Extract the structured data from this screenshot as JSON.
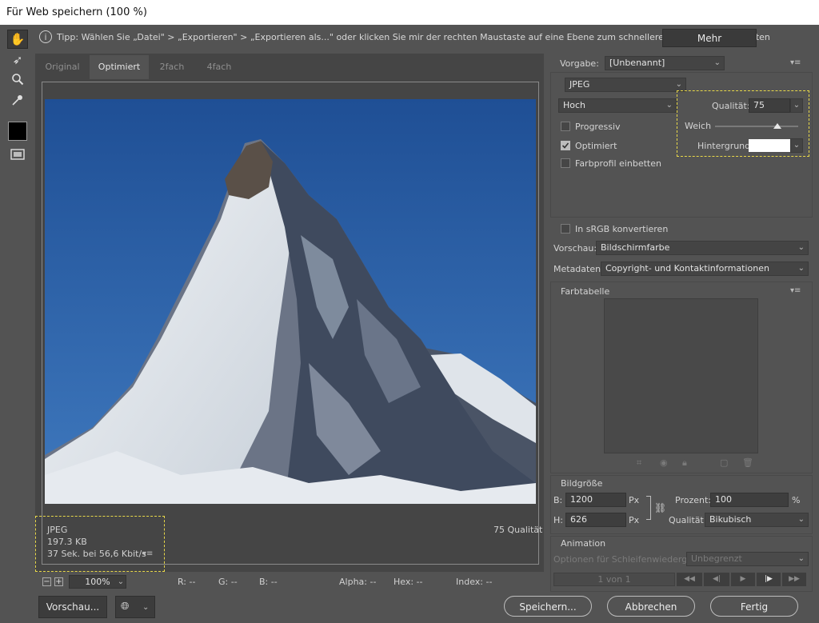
{
  "window": {
    "title": "Für Web speichern (100 %)"
  },
  "tip": {
    "text": "Tipp: Wählen Sie „Datei\" > „Exportieren\" > „Exportieren als...\" oder klicken Sie mir der rechten Maustaste auf eine Ebene zum schnelleren Export von Elementen",
    "more_label": "Mehr"
  },
  "tabs": [
    "Original",
    "Optimiert",
    "2fach",
    "4fach"
  ],
  "image_info": {
    "format": "JPEG",
    "size": "197.3 KB",
    "time": "37 Sek. bei 56,6 Kbit/s",
    "quality_label": "75 Qualität"
  },
  "statusbar": {
    "zoom": "100%",
    "r": "R: --",
    "g": "G: --",
    "b": "B: --",
    "alpha": "Alpha: --",
    "hex": "Hex: --",
    "index": "Index: --"
  },
  "settings": {
    "preset_label": "Vorgabe:",
    "preset_value": "[Unbenannt]",
    "format": "JPEG",
    "compression": "Hoch",
    "quality_label": "Qualität:",
    "quality_value": "75",
    "blur_label": "Weich",
    "blur_level": 0.75,
    "matte_label": "Hintergrund:",
    "progressive_label": "Progressiv",
    "optimized_label": "Optimiert",
    "embed_profile_label": "Farbprofil einbetten",
    "srgb_label": "In sRGB konvertieren",
    "preview_label": "Vorschau:",
    "preview_value": "Bildschirmfarbe",
    "metadata_label": "Metadaten:",
    "metadata_value": "Copyright- und Kontaktinformationen"
  },
  "color_table": {
    "title": "Farbtabelle"
  },
  "image_size": {
    "title": "Bildgröße",
    "w_label": "B:",
    "w_value": "1200",
    "h_label": "H:",
    "h_value": "626",
    "unit": "Px",
    "percent_label": "Prozent:",
    "percent_value": "100",
    "percent_unit": "%",
    "quality_label": "Qualität:",
    "quality_value": "Bikubisch"
  },
  "animation": {
    "title": "Animation",
    "loop_label": "Optionen für Schleifenwiedergabe:",
    "loop_value": "Unbegrenzt",
    "frame": "1 von 1"
  },
  "footer": {
    "preview": "Vorschau...",
    "save": "Speichern...",
    "cancel": "Abbrechen",
    "done": "Fertig"
  },
  "colors": {
    "accent_dashed": "#e8d84a",
    "sky": "#24579e"
  }
}
